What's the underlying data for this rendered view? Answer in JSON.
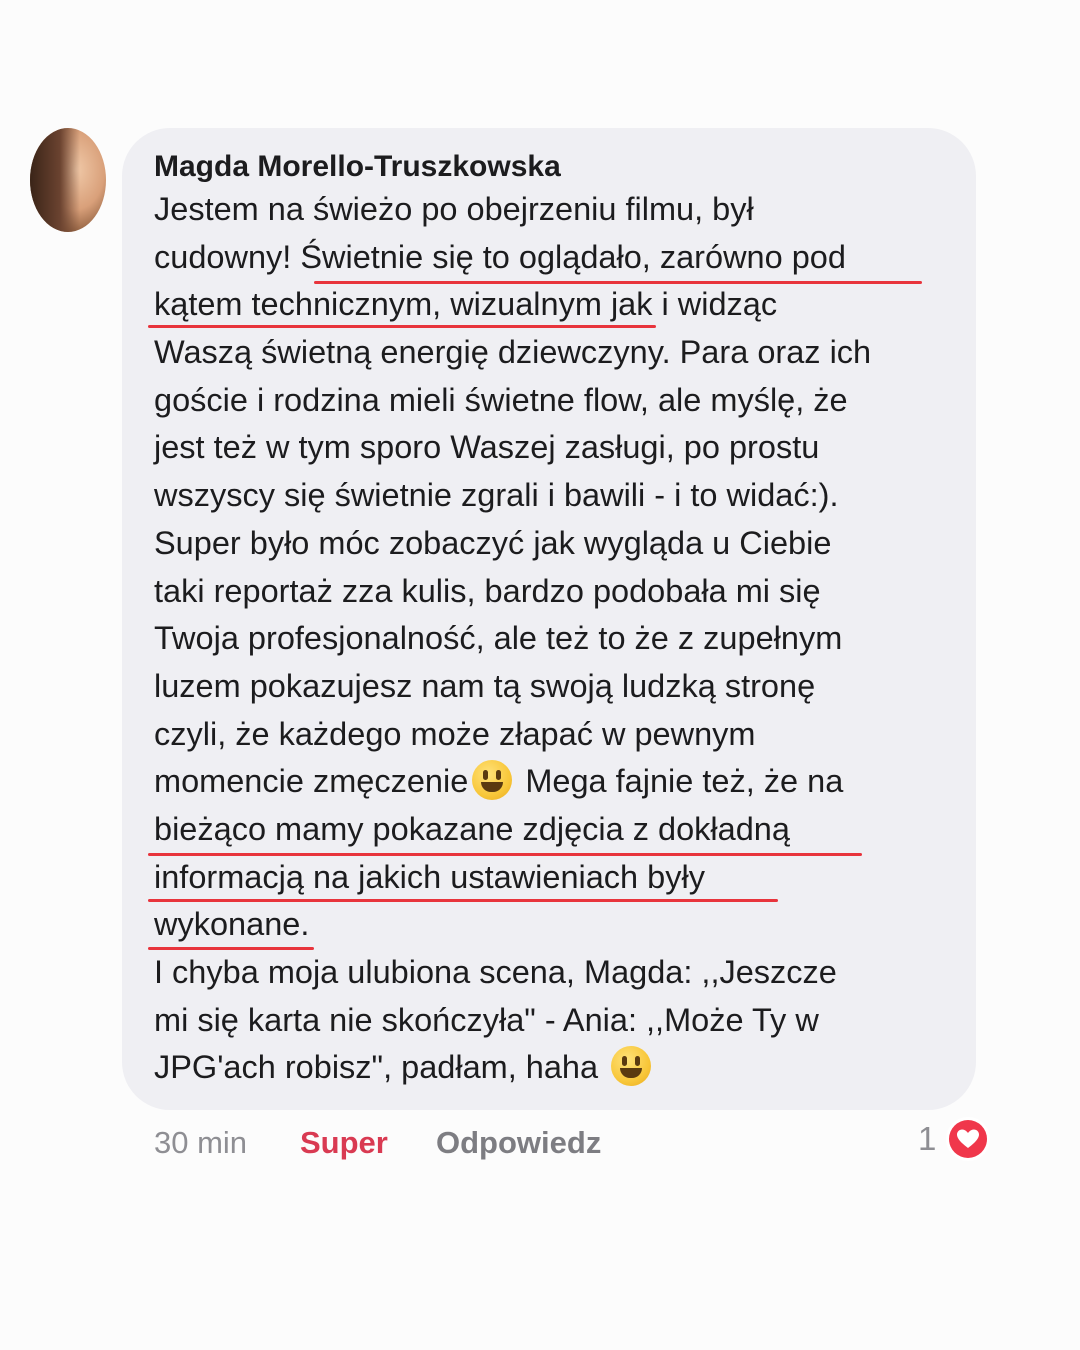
{
  "comment": {
    "author": "Magda Morello-Truszkowska",
    "lines": [
      "Jestem na świeżo po obejrzeniu filmu, był",
      "cudowny! Świetnie się to oglądało, zarówno pod",
      "kątem technicznym, wizualnym jak i widząc",
      "Waszą świetną energię dziewczyny. Para oraz ich",
      "goście i rodzina mieli świetne flow, ale myślę, że",
      "jest też w tym sporo Waszej zasługi, po prostu",
      "wszyscy się świetnie zgrali i bawili - i to widać:).",
      "Super było móc zobaczyć jak wygląda u Ciebie",
      "taki reportaż zza kulis, bardzo podobała mi się",
      "Twoja profesjonalność, ale też to że z zupełnym",
      "luzem pokazujesz nam tą swoją ludzką stronę",
      "czyli, że każdego może złapać w pewnym",
      "momencie zmęczenie",
      "Mega fajnie też, że na",
      "bieżąco mamy pokazane zdjęcia z dokładną",
      "informacją na jakich ustawieniach były",
      "wykonane.",
      "I chyba moja ulubiona scena, Magda: ,,Jeszcze",
      "mi się karta nie skończyła\" - Ania: ,,Może Ty w",
      "JPG'ach robisz\", padłam, haha"
    ],
    "emoji_icon": "smiley-emoji-icon",
    "time": "30 min",
    "reaction_label": "Super",
    "reply_label": "Odpowiedz",
    "like_count": "1",
    "like_icon": "heart-icon",
    "colors": {
      "bubble": "#efeff3",
      "underline": "#e8343c",
      "super": "#d93a52",
      "heart": "#f0374b"
    }
  }
}
